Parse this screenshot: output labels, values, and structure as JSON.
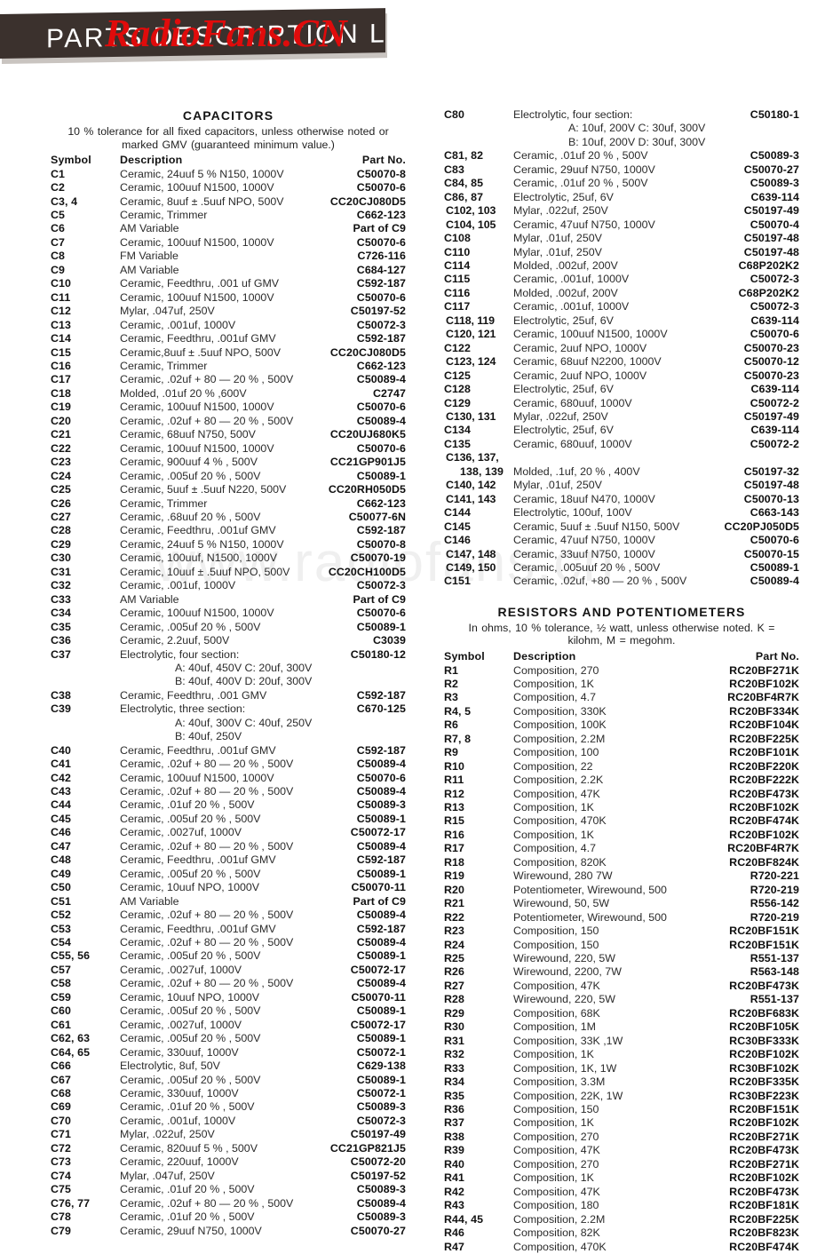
{
  "banner": {
    "title": "PARTS DESCRIPTION LIST",
    "bar_color": "#3b312d"
  },
  "watermarks": {
    "red": "RadioFans.CN",
    "red_color": "#e00b0b",
    "grey": "www.radiofans.cn",
    "grey_color": "#efefef"
  },
  "capacitors": {
    "title": "CAPACITORS",
    "note": "10 % tolerance for all fixed capacitors, unless otherwise noted or marked GMV (guaranteed minimum value.)",
    "columns": {
      "symbol": "Symbol",
      "description": "Description",
      "part": "Part No."
    },
    "rows_left": [
      {
        "symbol": "C1",
        "desc": "Ceramic, 24uuf 5 %  N150, 1000V",
        "part": "C50070-8"
      },
      {
        "symbol": "C2",
        "desc": "Ceramic, 100uuf N1500, 1000V",
        "part": "C50070-6"
      },
      {
        "symbol": "C3, 4",
        "desc": "Ceramic, 8uuf ± .5uuf NPO, 500V",
        "part": "CC20CJ080D5"
      },
      {
        "symbol": "C5",
        "desc": "Ceramic, Trimmer",
        "part": "C662-123"
      },
      {
        "symbol": "C6",
        "desc": "AM Variable",
        "part": "Part of C9"
      },
      {
        "symbol": "C7",
        "desc": "Ceramic, 100uuf N1500, 1000V",
        "part": "C50070-6"
      },
      {
        "symbol": "C8",
        "desc": "FM Variable",
        "part": "C726-116"
      },
      {
        "symbol": "C9",
        "desc": "AM Variable",
        "part": "C684-127"
      },
      {
        "symbol": "C10",
        "desc": "Ceramic, Feedthru, .001 uf GMV",
        "part": "C592-187"
      },
      {
        "symbol": "C11",
        "desc": "Ceramic, 100uuf N1500, 1000V",
        "part": "C50070-6"
      },
      {
        "symbol": "C12",
        "desc": "Mylar, .047uf, 250V",
        "part": "C50197-52"
      },
      {
        "symbol": "C13",
        "desc": "Ceramic, .001uf, 1000V",
        "part": "C50072-3"
      },
      {
        "symbol": "C14",
        "desc": "Ceramic, Feedthru, .001uf GMV",
        "part": "C592-187"
      },
      {
        "symbol": "C15",
        "desc": "Ceramic,8uuf ± .5uuf NPO, 500V",
        "part": "CC20CJ080D5"
      },
      {
        "symbol": "C16",
        "desc": "Ceramic, Trimmer",
        "part": "C662-123"
      },
      {
        "symbol": "C17",
        "desc": "Ceramic, .02uf + 80 — 20 % , 500V",
        "part": "C50089-4"
      },
      {
        "symbol": "C18",
        "desc": "Molded, .01uf 20 % ,600V",
        "part": "C2747"
      },
      {
        "symbol": "C19",
        "desc": "Ceramic, 100uuf N1500, 1000V",
        "part": "C50070-6"
      },
      {
        "symbol": "C20",
        "desc": "Ceramic, .02uf + 80 — 20 % , 500V",
        "part": "C50089-4"
      },
      {
        "symbol": "C21",
        "desc": "Ceramic, 68uuf N750, 500V",
        "part": "CC20UJ680K5"
      },
      {
        "symbol": "C22",
        "desc": "Ceramic, 100uuf N1500, 1000V",
        "part": "C50070-6"
      },
      {
        "symbol": "C23",
        "desc": "Ceramic, 900uuf 4 % , 500V",
        "part": "CC21GP901J5"
      },
      {
        "symbol": "C24",
        "desc": "Ceramic, .005uf 20 % , 500V",
        "part": "C50089-1"
      },
      {
        "symbol": "C25",
        "desc": "Ceramic, 5uuf ± .5uuf N220, 500V",
        "part": "CC20RH050D5"
      },
      {
        "symbol": "C26",
        "desc": "Ceramic, Trimmer",
        "part": "C662-123"
      },
      {
        "symbol": "C27",
        "desc": "Ceramic, .68uuf 20 % , 500V",
        "part": "C50077-6N"
      },
      {
        "symbol": "C28",
        "desc": "Ceramic, Feedthru, .001uf GMV",
        "part": "C592-187"
      },
      {
        "symbol": "C29",
        "desc": "Ceramic, 24uuf 5 %  N150, 1000V",
        "part": "C50070-8"
      },
      {
        "symbol": "C30",
        "desc": "Ceramic, 100uuf, N1500, 1000V",
        "part": "C50070-19"
      },
      {
        "symbol": "C31",
        "desc": "Ceramic, 10uuf ± .5uuf NPO, 500V",
        "part": "CC20CH100D5"
      },
      {
        "symbol": "C32",
        "desc": "Ceramic, .001uf, 1000V",
        "part": "C50072-3"
      },
      {
        "symbol": "C33",
        "desc": "AM Variable",
        "part": "Part of C9"
      },
      {
        "symbol": "C34",
        "desc": "Ceramic, 100uuf N1500, 1000V",
        "part": "C50070-6"
      },
      {
        "symbol": "C35",
        "desc": "Ceramic, .005uf 20 % , 500V",
        "part": "C50089-1"
      },
      {
        "symbol": "C36",
        "desc": "Ceramic, 2.2uuf, 500V",
        "part": "C3039"
      },
      {
        "symbol": "C37",
        "desc": "Electrolytic, four section:",
        "part": "C50180-12"
      },
      {
        "symbol": "",
        "desc": "A:    40uf, 450V     C:     20uf, 300V",
        "part": "",
        "sub": true
      },
      {
        "symbol": "",
        "desc": "B:    40uf, 400V     D:     20uf, 300V",
        "part": "",
        "sub": true
      },
      {
        "symbol": "C38",
        "desc": "Ceramic, Feedthru, .001 GMV",
        "part": "C592-187"
      },
      {
        "symbol": "C39",
        "desc": "Electrolytic, three section:",
        "part": "C670-125"
      },
      {
        "symbol": "",
        "desc": "A:    40uf, 300V      C:     40uf, 250V",
        "part": "",
        "sub": true
      },
      {
        "symbol": "",
        "desc": "B:    40uf, 250V",
        "part": "",
        "sub": true
      },
      {
        "symbol": "C40",
        "desc": "Ceramic, Feedthru, .001uf GMV",
        "part": "C592-187"
      },
      {
        "symbol": "C41",
        "desc": "Ceramic, .02uf + 80 — 20 % , 500V",
        "part": "C50089-4"
      },
      {
        "symbol": "C42",
        "desc": "Ceramic, 100uuf N1500, 1000V",
        "part": "C50070-6"
      },
      {
        "symbol": "C43",
        "desc": "Ceramic, .02uf + 80 — 20 % , 500V",
        "part": "C50089-4"
      },
      {
        "symbol": "C44",
        "desc": "Ceramic, .01uf 20 % , 500V",
        "part": "C50089-3"
      },
      {
        "symbol": "C45",
        "desc": "Ceramic, .005uf 20 % , 500V",
        "part": "C50089-1"
      },
      {
        "symbol": "C46",
        "desc": "Ceramic, .0027uf, 1000V",
        "part": "C50072-17"
      },
      {
        "symbol": "C47",
        "desc": "Ceramic, .02uf + 80 — 20 % , 500V",
        "part": "C50089-4"
      },
      {
        "symbol": "C48",
        "desc": "Ceramic, Feedthru, .001uf GMV",
        "part": "C592-187"
      },
      {
        "symbol": "C49",
        "desc": "Ceramic, .005uf 20 % , 500V",
        "part": "C50089-1"
      },
      {
        "symbol": "C50",
        "desc": "Ceramic, 10uuf NPO, 1000V",
        "part": "C50070-11"
      },
      {
        "symbol": "C51",
        "desc": "AM Variable",
        "part": "Part of C9"
      },
      {
        "symbol": "C52",
        "desc": "Ceramic, .02uf + 80 — 20 % , 500V",
        "part": "C50089-4"
      },
      {
        "symbol": "C53",
        "desc": "Ceramic, Feedthru, .001uf GMV",
        "part": "C592-187"
      },
      {
        "symbol": "C54",
        "desc": "Ceramic, .02uf + 80 — 20 % , 500V",
        "part": "C50089-4"
      },
      {
        "symbol": "C55, 56",
        "desc": "Ceramic, .005uf 20 % , 500V",
        "part": "C50089-1"
      },
      {
        "symbol": "C57",
        "desc": "Ceramic, .0027uf, 1000V",
        "part": "C50072-17"
      },
      {
        "symbol": "C58",
        "desc": "Ceramic, .02uf + 80 — 20 % , 500V",
        "part": "C50089-4"
      },
      {
        "symbol": "C59",
        "desc": "Ceramic, 10uuf NPO, 1000V",
        "part": "C50070-11"
      },
      {
        "symbol": "C60",
        "desc": "Ceramic, .005uf 20 % , 500V",
        "part": "C50089-1"
      },
      {
        "symbol": "C61",
        "desc": "Ceramic, .0027uf, 1000V",
        "part": "C50072-17"
      },
      {
        "symbol": "C62, 63",
        "desc": "Ceramic, .005uf 20 % , 500V",
        "part": "C50089-1"
      },
      {
        "symbol": "C64, 65",
        "desc": "Ceramic, 330uuf, 1000V",
        "part": "C50072-1"
      },
      {
        "symbol": "C66",
        "desc": "Electrolytic, 8uf, 50V",
        "part": "C629-138"
      },
      {
        "symbol": "C67",
        "desc": "Ceramic, .005uf 20 % , 500V",
        "part": "C50089-1"
      },
      {
        "symbol": "C68",
        "desc": "Ceramic, 330uuf, 1000V",
        "part": "C50072-1"
      },
      {
        "symbol": "C69",
        "desc": "Ceramic,  .01uf 20 % , 500V",
        "part": "C50089-3"
      },
      {
        "symbol": "C70",
        "desc": "Ceramic,  .001uf, 1000V",
        "part": "C50072-3"
      },
      {
        "symbol": "C71",
        "desc": "Mylar, .022uf, 250V",
        "part": "C50197-49"
      },
      {
        "symbol": "C72",
        "desc": "Ceramic, 820uuf 5 % , 500V",
        "part": "CC21GP821J5"
      },
      {
        "symbol": "C73",
        "desc": "Ceramic, 220uuf, 1000V",
        "part": "C50072-20"
      },
      {
        "symbol": "C74",
        "desc": "Mylar, .047uf, 250V",
        "part": "C50197-52"
      },
      {
        "symbol": "C75",
        "desc": "Ceramic,  .01uf 20 % , 500V",
        "part": "C50089-3"
      },
      {
        "symbol": "C76, 77",
        "desc": "Ceramic, .02uf + 80 — 20 % , 500V",
        "part": "C50089-4"
      },
      {
        "symbol": "C78",
        "desc": "Ceramic, .01uf 20 % , 500V",
        "part": "C50089-3"
      },
      {
        "symbol": "C79",
        "desc": "Ceramic, 29uuf N750, 1000V",
        "part": "C50070-27"
      }
    ],
    "rows_right": [
      {
        "symbol": "C80",
        "desc": "Electrolytic, four section:",
        "part": "C50180-1"
      },
      {
        "symbol": "",
        "desc": "A:    10uf, 200V        C:      30uf, 300V",
        "part": "",
        "sub": true
      },
      {
        "symbol": "",
        "desc": "B:    10uf, 200V        D:      30uf, 300V",
        "part": "",
        "sub": true
      },
      {
        "symbol": "C81, 82",
        "desc": "Ceramic, .01uf 20 % , 500V",
        "part": "C50089-3"
      },
      {
        "symbol": "C83",
        "desc": "Ceramic, 29uuf N750, 1000V",
        "part": "C50070-27"
      },
      {
        "symbol": "C84, 85",
        "desc": "Ceramic, .01uf 20 % , 500V",
        "part": "C50089-3"
      },
      {
        "symbol": "C86, 87",
        "desc": "Electrolytic, 25uf, 6V",
        "part": "C639-114"
      },
      {
        "symbol": "C102, 103",
        "desc": "Mylar, .022uf, 250V",
        "part": "C50197-49",
        "wide": true
      },
      {
        "symbol": "C104, 105",
        "desc": "Ceramic, 47uuf N750, 1000V",
        "part": "C50070-4",
        "wide": true
      },
      {
        "symbol": "C108",
        "desc": "Mylar, .01uf, 250V",
        "part": "C50197-48"
      },
      {
        "symbol": "C110",
        "desc": "Mylar, .01uf, 250V",
        "part": "C50197-48"
      },
      {
        "symbol": "C114",
        "desc": "Molded, .002uf, 200V",
        "part": "C68P202K2"
      },
      {
        "symbol": "C115",
        "desc": "Ceramic, .001uf, 1000V",
        "part": "C50072-3"
      },
      {
        "symbol": "C116",
        "desc": "Molded, .002uf, 200V",
        "part": "C68P202K2"
      },
      {
        "symbol": "C117",
        "desc": "Ceramic, .001uf, 1000V",
        "part": "C50072-3"
      },
      {
        "symbol": "C118, 119",
        "desc": "Electrolytic, 25uf, 6V",
        "part": "C639-114",
        "wide": true
      },
      {
        "symbol": "C120, 121",
        "desc": "Ceramic, 100uuf N1500, 1000V",
        "part": "C50070-6",
        "wide": true
      },
      {
        "symbol": "C122",
        "desc": "Ceramic, 2uuf NPO, 1000V",
        "part": "C50070-23"
      },
      {
        "symbol": "C123, 124",
        "desc": "Ceramic, 68uuf N2200, 1000V",
        "part": "C50070-12",
        "wide": true
      },
      {
        "symbol": "C125",
        "desc": "Ceramic, 2uuf NPO, 1000V",
        "part": "C50070-23"
      },
      {
        "symbol": "C128",
        "desc": "Electrolytic, 25uf, 6V",
        "part": "C639-114"
      },
      {
        "symbol": "C129",
        "desc": "Ceramic, 680uuf, 1000V",
        "part": "C50072-2"
      },
      {
        "symbol": "C130, 131",
        "desc": "Mylar, .022uf, 250V",
        "part": "C50197-49",
        "wide": true
      },
      {
        "symbol": "C134",
        "desc": "Electrolytic, 25uf, 6V",
        "part": "C639-114"
      },
      {
        "symbol": "C135",
        "desc": "Ceramic, 680uuf, 1000V",
        "part": "C50072-2"
      },
      {
        "symbol": "C136, 137,",
        "desc": "",
        "part": "",
        "wide": true
      },
      {
        "symbol": "138, 139",
        "desc": "Molded, .1uf, 20 % , 400V",
        "part": "C50197-32",
        "indent": true
      },
      {
        "symbol": "C140, 142",
        "desc": "Mylar, .01uf, 250V",
        "part": "C50197-48",
        "wide": true
      },
      {
        "symbol": "C141, 143",
        "desc": "Ceramic, 18uuf N470, 1000V",
        "part": "C50070-13",
        "wide": true
      },
      {
        "symbol": "C144",
        "desc": "Electrolytic, 100uf, 100V",
        "part": "C663-143"
      },
      {
        "symbol": "C145",
        "desc": "Ceramic, 5uuf ± .5uuf N150, 500V",
        "part": "CC20PJ050D5"
      },
      {
        "symbol": "C146",
        "desc": "Ceramic, 47uuf N750, 1000V",
        "part": "C50070-6"
      },
      {
        "symbol": "C147, 148",
        "desc": "Ceramic, 33uuf N750, 1000V",
        "part": "C50070-15",
        "wide": true
      },
      {
        "symbol": "C149, 150",
        "desc": "Ceramic, .005uuf 20 % , 500V",
        "part": "C50089-1",
        "wide": true
      },
      {
        "symbol": "C151",
        "desc": "Ceramic, .02uf, +80 — 20 % , 500V",
        "part": "C50089-4"
      }
    ]
  },
  "resistors": {
    "title": "RESISTORS AND POTENTIOMETERS",
    "note": "In ohms, 10 % tolerance, ½ watt, unless otherwise noted.   K = kilohm,  M = megohm.",
    "columns": {
      "symbol": "Symbol",
      "description": "Description",
      "part": "Part No."
    },
    "rows": [
      {
        "symbol": "R1",
        "desc": "Composition, 270",
        "part": "RC20BF271K"
      },
      {
        "symbol": "R2",
        "desc": "Composition, 1K",
        "part": "RC20BF102K"
      },
      {
        "symbol": "R3",
        "desc": "Composition, 4.7",
        "part": "RC20BF4R7K"
      },
      {
        "symbol": "R4, 5",
        "desc": "Composition, 330K",
        "part": "RC20BF334K"
      },
      {
        "symbol": "R6",
        "desc": "Composition, 100K",
        "part": "RC20BF104K"
      },
      {
        "symbol": "R7, 8",
        "desc": "Composition, 2.2M",
        "part": "RC20BF225K"
      },
      {
        "symbol": "R9",
        "desc": "Composition, 100",
        "part": "RC20BF101K"
      },
      {
        "symbol": "R10",
        "desc": "Composition, 22",
        "part": "RC20BF220K"
      },
      {
        "symbol": "R11",
        "desc": "Composition, 2.2K",
        "part": "RC20BF222K"
      },
      {
        "symbol": "R12",
        "desc": "Composition, 47K",
        "part": "RC20BF473K"
      },
      {
        "symbol": "R13",
        "desc": "Composition, 1K",
        "part": "RC20BF102K"
      },
      {
        "symbol": "R15",
        "desc": "Composition, 470K",
        "part": "RC20BF474K"
      },
      {
        "symbol": "R16",
        "desc": "Composition, 1K",
        "part": "RC20BF102K"
      },
      {
        "symbol": "R17",
        "desc": "Composition, 4.7",
        "part": "RC20BF4R7K"
      },
      {
        "symbol": "R18",
        "desc": "Composition, 820K",
        "part": "RC20BF824K"
      },
      {
        "symbol": "R19",
        "desc": "Wirewound, 280 7W",
        "part": "R720-221"
      },
      {
        "symbol": "R20",
        "desc": "Potentiometer, Wirewound, 500",
        "part": "R720-219"
      },
      {
        "symbol": "R21",
        "desc": "Wirewound, 50, 5W",
        "part": "R556-142"
      },
      {
        "symbol": "R22",
        "desc": "Potentiometer, Wirewound, 500",
        "part": "R720-219"
      },
      {
        "symbol": "R23",
        "desc": "Composition, 150",
        "part": "RC20BF151K"
      },
      {
        "symbol": "R24",
        "desc": "Composition, 150",
        "part": "RC20BF151K"
      },
      {
        "symbol": "R25",
        "desc": "Wirewound, 220, 5W",
        "part": "R551-137"
      },
      {
        "symbol": "R26",
        "desc": "Wirewound, 2200, 7W",
        "part": "R563-148"
      },
      {
        "symbol": "R27",
        "desc": "Composition, 47K",
        "part": "RC20BF473K"
      },
      {
        "symbol": "R28",
        "desc": "Wirewound, 220, 5W",
        "part": "R551-137"
      },
      {
        "symbol": "R29",
        "desc": "Composition, 68K",
        "part": "RC20BF683K"
      },
      {
        "symbol": "R30",
        "desc": "Composition, 1M",
        "part": "RC20BF105K"
      },
      {
        "symbol": "R31",
        "desc": "Composition, 33K ,1W",
        "part": "RC30BF333K"
      },
      {
        "symbol": "R32",
        "desc": "Composition, 1K",
        "part": "RC20BF102K"
      },
      {
        "symbol": "R33",
        "desc": "Composition, 1K, 1W",
        "part": "RC30BF102K"
      },
      {
        "symbol": "R34",
        "desc": "Composition, 3.3M",
        "part": "RC20BF335K"
      },
      {
        "symbol": "R35",
        "desc": "Composition, 22K, 1W",
        "part": "RC30BF223K"
      },
      {
        "symbol": "R36",
        "desc": "Composition, 150",
        "part": "RC20BF151K"
      },
      {
        "symbol": "R37",
        "desc": "Composition, 1K",
        "part": "RC20BF102K"
      },
      {
        "symbol": "R38",
        "desc": "Composition, 270",
        "part": "RC20BF271K"
      },
      {
        "symbol": "R39",
        "desc": "Composition, 47K",
        "part": "RC20BF473K"
      },
      {
        "symbol": "R40",
        "desc": "Composition, 270",
        "part": "RC20BF271K"
      },
      {
        "symbol": "R41",
        "desc": "Composition, 1K",
        "part": "RC20BF102K"
      },
      {
        "symbol": "R42",
        "desc": "Composition, 47K",
        "part": "RC20BF473K"
      },
      {
        "symbol": "R43",
        "desc": "Composition, 180",
        "part": "RC20BF181K"
      },
      {
        "symbol": "R44, 45",
        "desc": "Composition, 2.2M",
        "part": "RC20BF225K"
      },
      {
        "symbol": "R46",
        "desc": "Composition, 82K",
        "part": "RC20BF823K"
      },
      {
        "symbol": "R47",
        "desc": "Composition, 470K",
        "part": "RC20BF474K"
      }
    ]
  }
}
